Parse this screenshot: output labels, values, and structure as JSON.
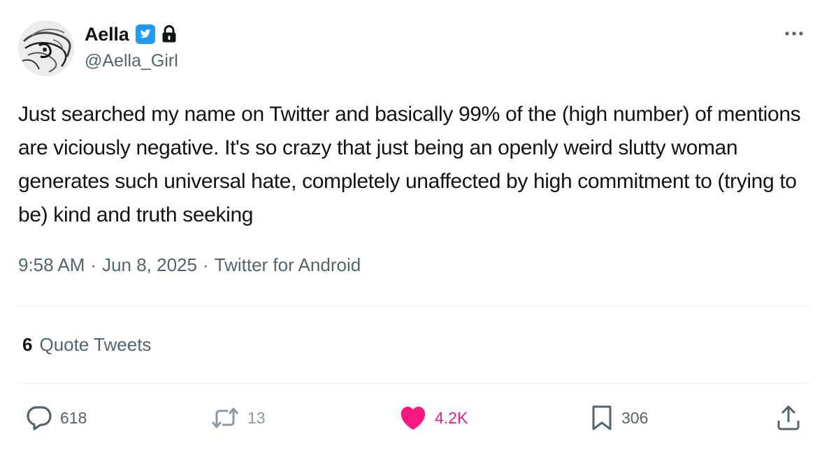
{
  "author": {
    "display_name": "Aella",
    "handle": "@Aella_Girl",
    "verified": true,
    "protected": true,
    "verified_color": "#1d9bf0"
  },
  "tweet": {
    "text": "Just searched my name on Twitter and basically 99% of the (high number) of mentions are viciously negative. It's so crazy that just being an openly weird slutty woman generates such universal hate, completely unaffected by high commitment to (trying to be) kind and truth seeking",
    "time": "9:58 AM",
    "date": "Jun 8, 2025",
    "source": "Twitter for Android",
    "separator": "·"
  },
  "quote_tweets": {
    "count": "6",
    "label": "Quote Tweets"
  },
  "actions": {
    "replies": "618",
    "retweets": "13",
    "likes": "4.2K",
    "bookmarks": "306",
    "like_color": "#f91880"
  },
  "icons": [
    "verified-badge-icon",
    "lock-icon",
    "more-icon",
    "reply-icon",
    "retweet-icon",
    "heart-icon",
    "bookmark-icon",
    "share-icon"
  ]
}
